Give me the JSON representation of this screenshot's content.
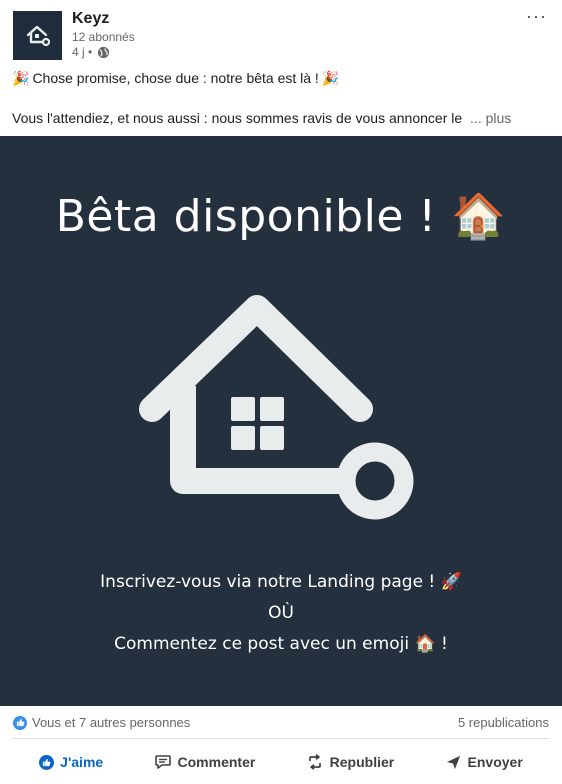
{
  "post": {
    "author": {
      "name": "Keyz",
      "followers": "12 abonnés",
      "time": "4 j •",
      "visibility_icon": "globe-icon"
    },
    "more_label": "···",
    "text": {
      "line1": "Chose promise, chose due : notre bêta est là !",
      "line1_emoji": "🎉",
      "line2": "Vous l'attendiez, et nous aussi : nous sommes ravis de vous annoncer le",
      "see_more": "... plus"
    },
    "image": {
      "title": "Bêta disponible ! 🏠",
      "line1": "Inscrivez-vous via notre Landing page ! 🚀",
      "line2": "OÙ",
      "line3": "Commentez ce post avec un emoji 🏠 !"
    },
    "social": {
      "reactions": "Vous et 7 autres personnes",
      "reposts": "5 republications"
    },
    "actions": {
      "like": "J'aime",
      "comment": "Commenter",
      "repost": "Republier",
      "send": "Envoyer"
    }
  },
  "colors": {
    "image_background": "#25303f",
    "logo_background": "#1f2c3b",
    "accent": "#0a66c2",
    "like_badge": "#378fe9"
  }
}
